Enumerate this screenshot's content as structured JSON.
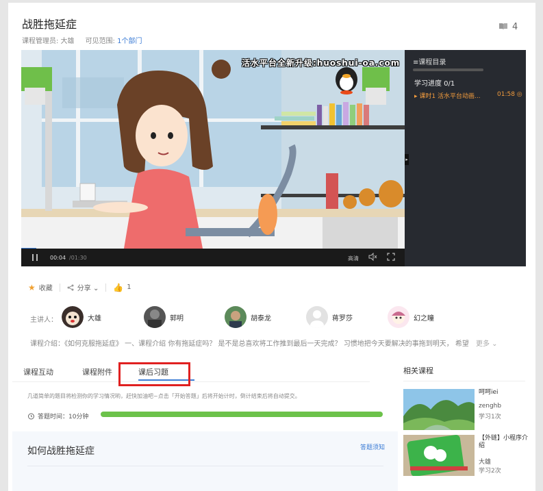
{
  "course": {
    "title": "战胜拖延症",
    "manager_label": "课程管理员: 大雄",
    "scope_label": "可见范围:",
    "scope_link": "1个部门",
    "book_count": "4"
  },
  "video": {
    "overlay_text": "活水平台全新升级:huoshui-oa.com",
    "current_time": "00:04",
    "total_time": "/01:30",
    "quality": "高清",
    "progress": 0.04
  },
  "catalog": {
    "header": "≡课程目录",
    "progress_label": "学习进度 0/1",
    "lesson": "▸ 课时1 活水平台动画...",
    "lesson_duration": "01:58 ◎"
  },
  "actions": {
    "favorite": "收藏",
    "share": "分享 ⌄",
    "likes": "1"
  },
  "presenters": {
    "label": "主讲人：",
    "items": [
      {
        "name": "大雄"
      },
      {
        "name": "郭明"
      },
      {
        "name": "胡泰龙"
      },
      {
        "name": "蒋罗莎"
      },
      {
        "name": "幻之瞳"
      }
    ]
  },
  "intro": {
    "text": "课程介绍：《如何克服拖延症》 一、课程介绍 你有拖延症吗？ 是不是总喜欢将工作推到最后一天完成？ 习惯地把今天要解决的事拖到明天， 希望...",
    "more": "更多 ⌄"
  },
  "tabs": [
    {
      "label": "课程互动"
    },
    {
      "label": "课程附件"
    },
    {
      "label": "课后习题"
    }
  ],
  "exercise": {
    "hint": "几道简单的题目将检测你的学习情况哟，赶快加油吧~点击「开始答题」后将开始计时，倒计结束后将自动提交。",
    "timer": "答题时间：10分钟",
    "title": "如何战胜拖延症",
    "notice_link": "答题须知"
  },
  "related": {
    "title": "相关课程",
    "items": [
      {
        "name": "呵呵iei",
        "author": "zenghb",
        "count": "学习1次"
      },
      {
        "name": "【外链】小程序介绍",
        "author": "大雄",
        "count": "学习2次"
      }
    ]
  },
  "colors": {
    "accent": "#3a7bd5",
    "catalog_bg": "#272a30",
    "lesson_active": "#f39c3d",
    "timer_bar": "#6cc24a",
    "highlight_box": "#e02020"
  }
}
